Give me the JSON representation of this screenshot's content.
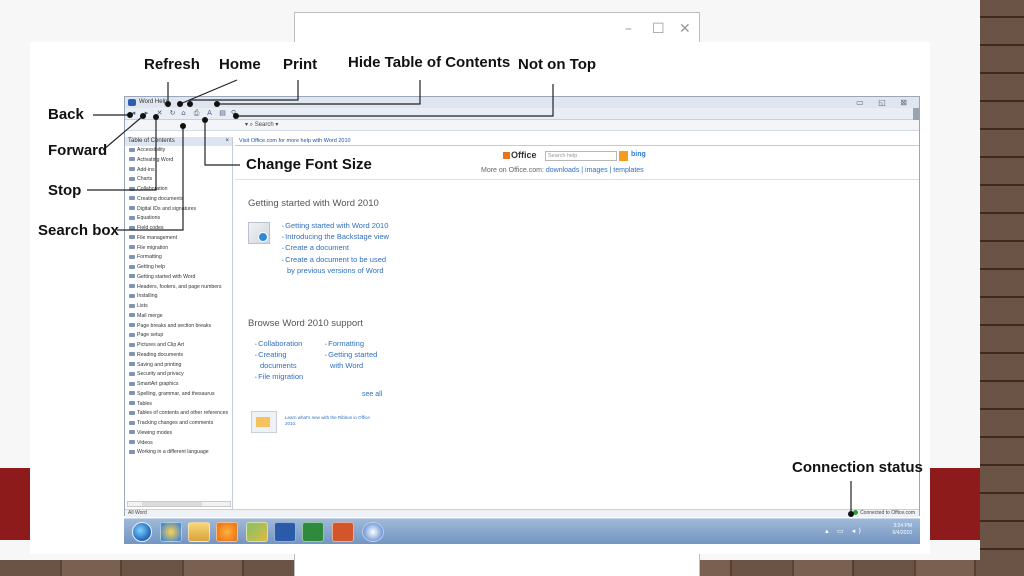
{
  "callouts": {
    "refresh": "Refresh",
    "home": "Home",
    "print": "Print",
    "hide_toc": "Hide Table of Contents",
    "not_on_top": "Not on Top",
    "back": "Back",
    "forward": "Forward",
    "stop": "Stop",
    "search_box": "Search box",
    "change_font_size": "Change Font Size",
    "connection_status": "Connection status"
  },
  "ghost_window": {
    "controls": [
      "–",
      "☐",
      "✕"
    ]
  },
  "help_window": {
    "title": "Word Help",
    "window_controls": "▭ ◱ ⊠",
    "search_label": "▾ ⌕ Search ▾",
    "toolbar_icons": [
      "back-icon",
      "forward-icon",
      "stop-icon",
      "refresh-icon",
      "home-icon",
      "print-icon",
      "font-size-icon",
      "hide-toc-icon",
      "pin-icon"
    ]
  },
  "toc": {
    "header": "Table of Contents",
    "close": "×",
    "items": [
      "Accessibility",
      "Activating Word",
      "Add-ins",
      "Charts",
      "Collaboration",
      "Creating documents",
      "Digital IDs and signatures",
      "Equations",
      "Field codes",
      "File management",
      "File migration",
      "Formatting",
      "Getting help",
      "Getting started with Word",
      "Headers, footers, and page numbers",
      "Installing",
      "Lists",
      "Mail merge",
      "Page breaks and section breaks",
      "Page setup",
      "Pictures and Clip Art",
      "Reading documents",
      "Saving and printing",
      "Security and privacy",
      "SmartArt graphics",
      "Spelling, grammar, and thesaurus",
      "Tables",
      "Tables of contents and other references",
      "Tracking changes and comments",
      "Viewing modes",
      "Videos",
      "Working in a different language"
    ]
  },
  "content": {
    "top_link": "Visit Office.com for more help with Word 2010",
    "office_logo": "Office",
    "search_placeholder": "Search help",
    "bing": "bing",
    "more_on_label": "More on Office.com:",
    "more_links": "downloads | images | templates",
    "getting_started": {
      "title": "Getting started with Word 2010",
      "links": [
        "Getting started with Word 2010",
        "Introducing the Backstage view",
        "Create a document",
        "Create a document to be used by previous versions of Word"
      ]
    },
    "browse": {
      "title": "Browse Word 2010 support",
      "col1": [
        "Collaboration",
        "Creating documents",
        "File migration"
      ],
      "col2": [
        "Formatting",
        "Getting started with Word"
      ],
      "see_all": "see all"
    },
    "ribbon_promo": "Learn what's new with the Ribbon in Office 2010."
  },
  "status": {
    "left": "All Word",
    "connection": "Connected to Office.com"
  },
  "taskbar": {
    "time": "3:24 PM",
    "date": "6/4/2010"
  }
}
